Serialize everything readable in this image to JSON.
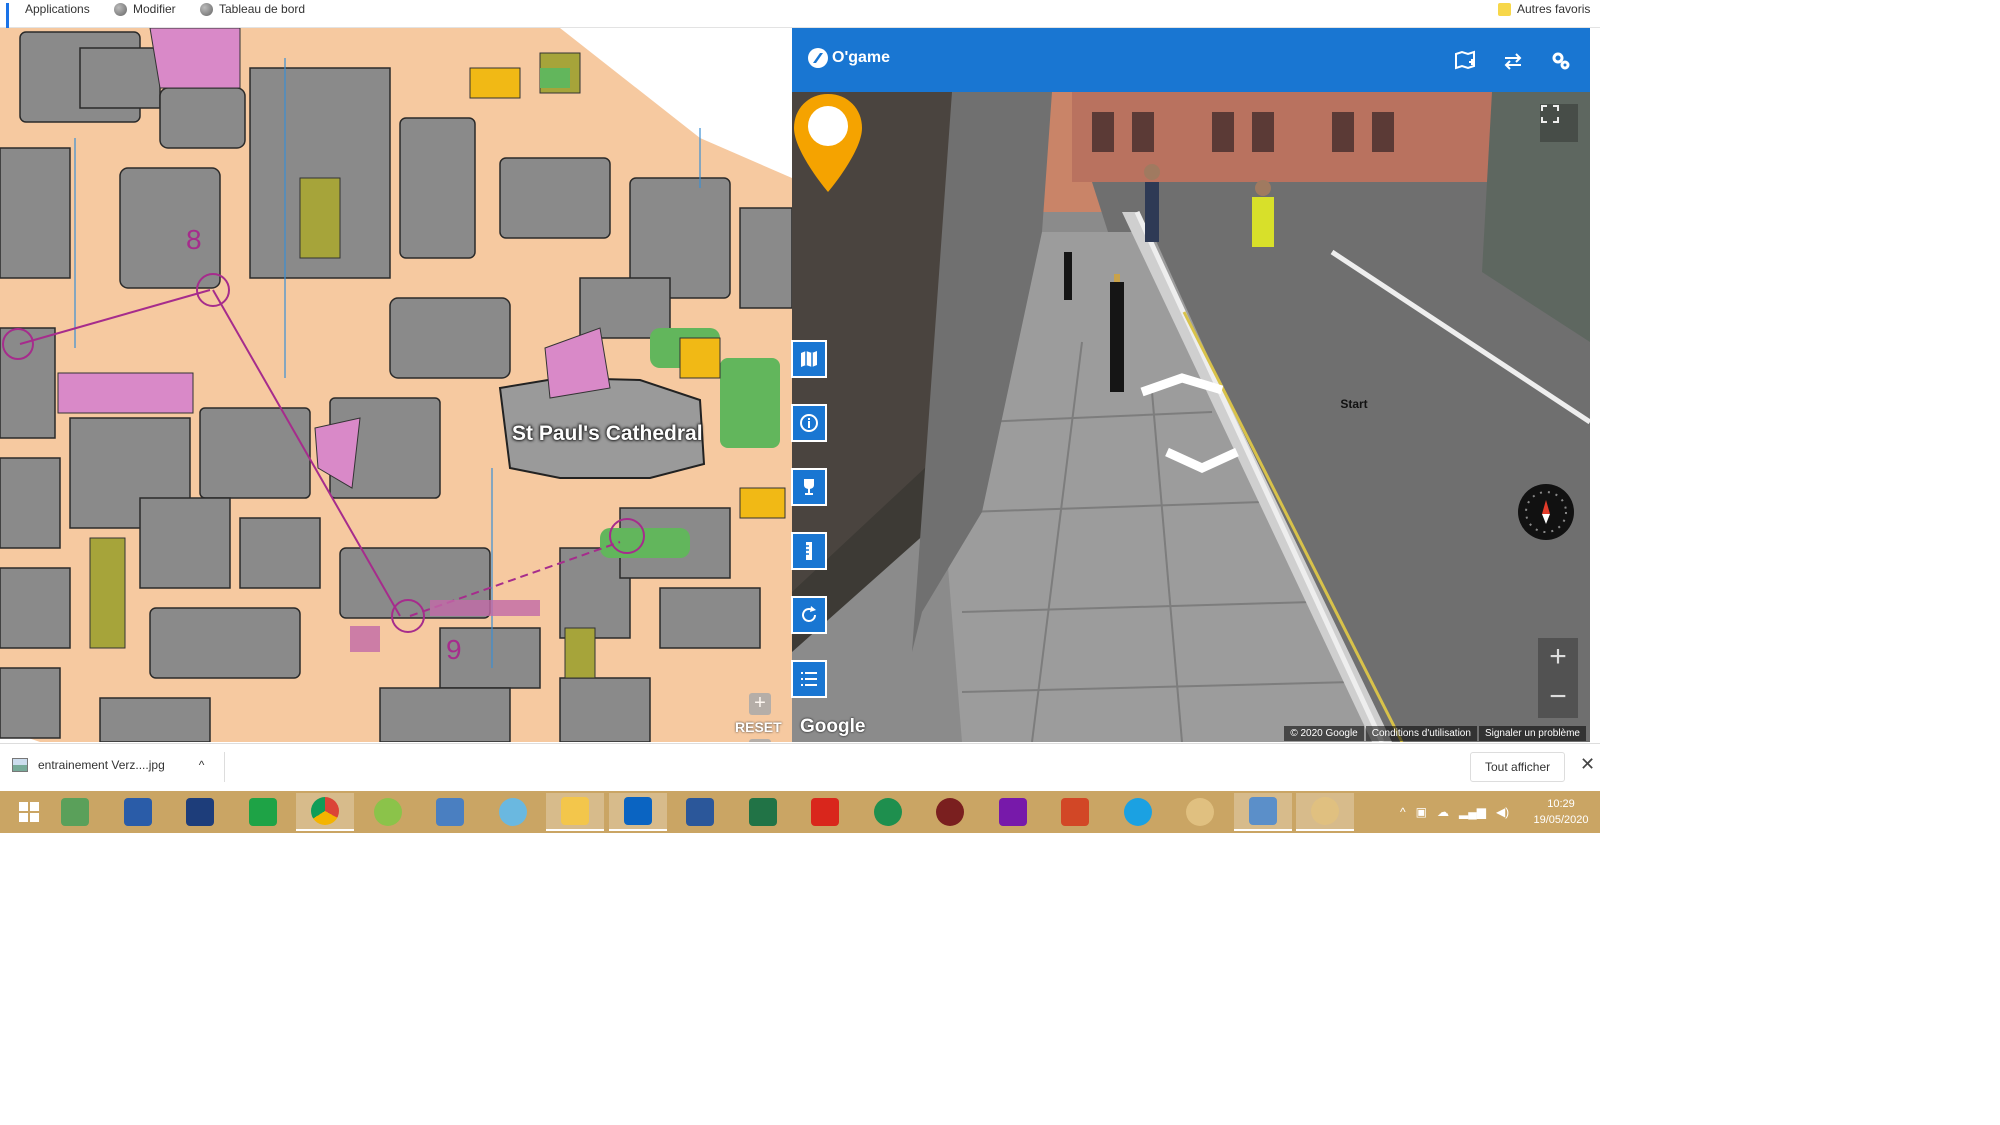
{
  "bookmarks": {
    "items": [
      {
        "label": "Applications"
      },
      {
        "label": "Modifier"
      },
      {
        "label": "Tableau de bord"
      }
    ],
    "other_favorites": "Autres favoris"
  },
  "map": {
    "landmark_label": "St Paul's Cathedral",
    "control_numbers": [
      "8",
      "9"
    ],
    "reset_label": "RESET",
    "zoom_in": "+",
    "zoom_out": "−"
  },
  "app": {
    "name": "O'game",
    "header_icons": [
      "map-add-icon",
      "swap-arrows-icon",
      "settings-gears-icon"
    ],
    "side_tools": [
      "map-icon",
      "info-icon",
      "trophy-icon",
      "ruler-icon",
      "refresh-icon",
      "list-icon"
    ],
    "accent_color": "#1976d2"
  },
  "streetview": {
    "google_logo": "Google",
    "start_label": "Start",
    "pin_color": "#f5a300",
    "attribution": [
      "© 2020 Google",
      "Conditions d'utilisation",
      "Signaler un problème"
    ],
    "zoom_in": "+",
    "zoom_out": "−"
  },
  "downloads": {
    "file_name": "entrainement Verz....jpg",
    "show_all": "Tout afficher",
    "close": "✕"
  },
  "taskbar": {
    "apps": [
      {
        "name": "evernote"
      },
      {
        "name": "messaging"
      },
      {
        "name": "remote-desktop"
      },
      {
        "name": "store"
      },
      {
        "name": "chrome"
      },
      {
        "name": "qgis"
      },
      {
        "name": "control-panel"
      },
      {
        "name": "a-app"
      },
      {
        "name": "file-explorer"
      },
      {
        "name": "outlook"
      },
      {
        "name": "word"
      },
      {
        "name": "excel"
      },
      {
        "name": "pdf"
      },
      {
        "name": "a-green"
      },
      {
        "name": "media"
      },
      {
        "name": "onenote"
      },
      {
        "name": "powerpoint"
      },
      {
        "name": "internet-explorer"
      },
      {
        "name": "paint"
      },
      {
        "name": "photos"
      },
      {
        "name": "paint-2"
      }
    ],
    "clock_time": "10:29",
    "clock_date": "19/05/2020"
  }
}
